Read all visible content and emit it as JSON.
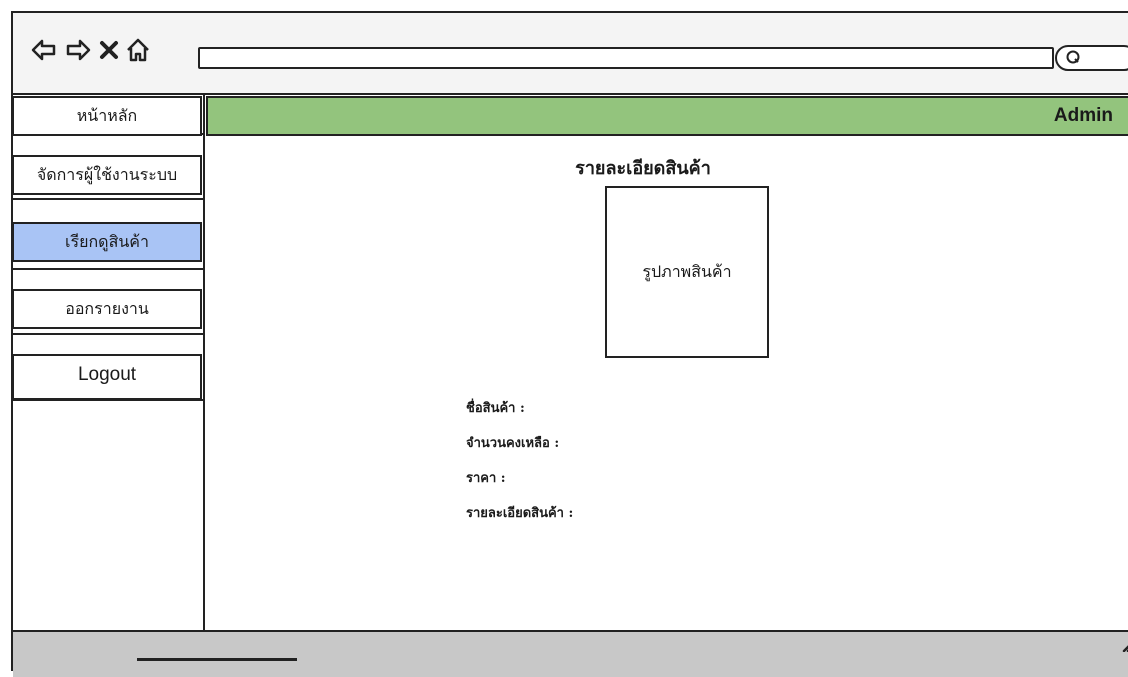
{
  "browser": {
    "icons": [
      "back-arrow-icon",
      "forward-arrow-icon",
      "close-icon",
      "home-icon",
      "search-icon"
    ],
    "url_value": ""
  },
  "sidebar": {
    "items": [
      {
        "label": "หน้าหลัก",
        "active": false
      },
      {
        "label": "จัดการผู้ใช้งานระบบ",
        "active": false
      },
      {
        "label": "เรียกดูสินค้า",
        "active": true
      },
      {
        "label": "ออกรายงาน",
        "active": false
      },
      {
        "label": "Logout",
        "active": false
      }
    ]
  },
  "header": {
    "user": "Admin"
  },
  "main": {
    "title": "รายละเอียดสินค้า",
    "image_placeholder": "รูปภาพสินค้า",
    "fields": [
      "ชื่อสินค้า :",
      "จำนวนคงเหลือ :",
      "ราคา :",
      "รายละเอียดสินค้า :"
    ]
  },
  "colors": {
    "header_bg": "#93c47d",
    "active_item_bg": "#a9c4f5",
    "footer_bg": "#c8c8c8"
  }
}
